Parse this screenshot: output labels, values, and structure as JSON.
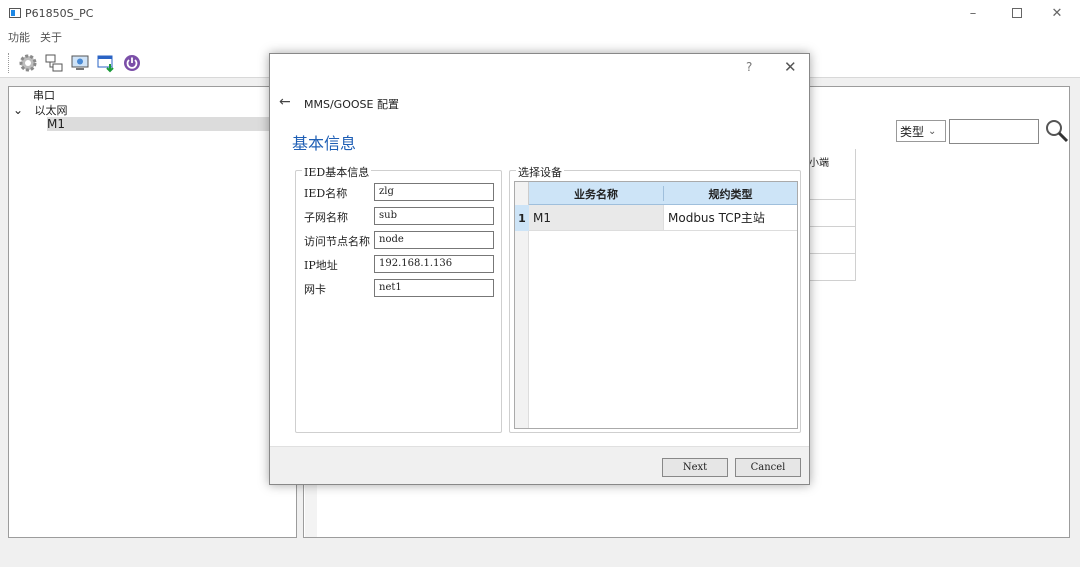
{
  "window": {
    "title": "P61850S_PC",
    "minimize": "–",
    "close": "✕"
  },
  "menu": [
    "功能",
    "关于"
  ],
  "toolbar": [
    "gear-icon",
    "network-icon",
    "monitor-icon",
    "window-download-icon",
    "power-icon"
  ],
  "tree": {
    "items": [
      {
        "label": "串口",
        "level": 0
      },
      {
        "label": "以太网",
        "level": 0,
        "expander": "⌄"
      },
      {
        "label": "M1",
        "level": 1,
        "selected": true
      }
    ]
  },
  "rightpanel": {
    "type_select": "类型",
    "type_chevron": "⌄",
    "column_fragment": "小端"
  },
  "dialog": {
    "help": "?",
    "close": "✕",
    "back": "←",
    "nav_title": "MMS/GOOSE 配置",
    "heading": "基本信息",
    "ied_group": {
      "legend": "IED基本信息",
      "fields": [
        {
          "label": "IED名称",
          "value": "zlg"
        },
        {
          "label": "子网名称",
          "value": "sub"
        },
        {
          "label": "访问节点名称",
          "value": "node"
        },
        {
          "label": "IP地址",
          "value": "192.168.1.136"
        },
        {
          "label": "网卡",
          "value": "net1"
        }
      ]
    },
    "device_group": {
      "legend": "选择设备",
      "columns": [
        "业务名称",
        "规约类型"
      ],
      "rows": [
        {
          "index": "1",
          "name": "M1",
          "protocol": "Modbus TCP主站"
        }
      ]
    },
    "buttons": {
      "next": "Next",
      "cancel": "Cancel"
    }
  },
  "colors": {
    "accent": "#1f5fb5",
    "table_header": "#cde4f7",
    "selection": "#dcdcdc"
  }
}
